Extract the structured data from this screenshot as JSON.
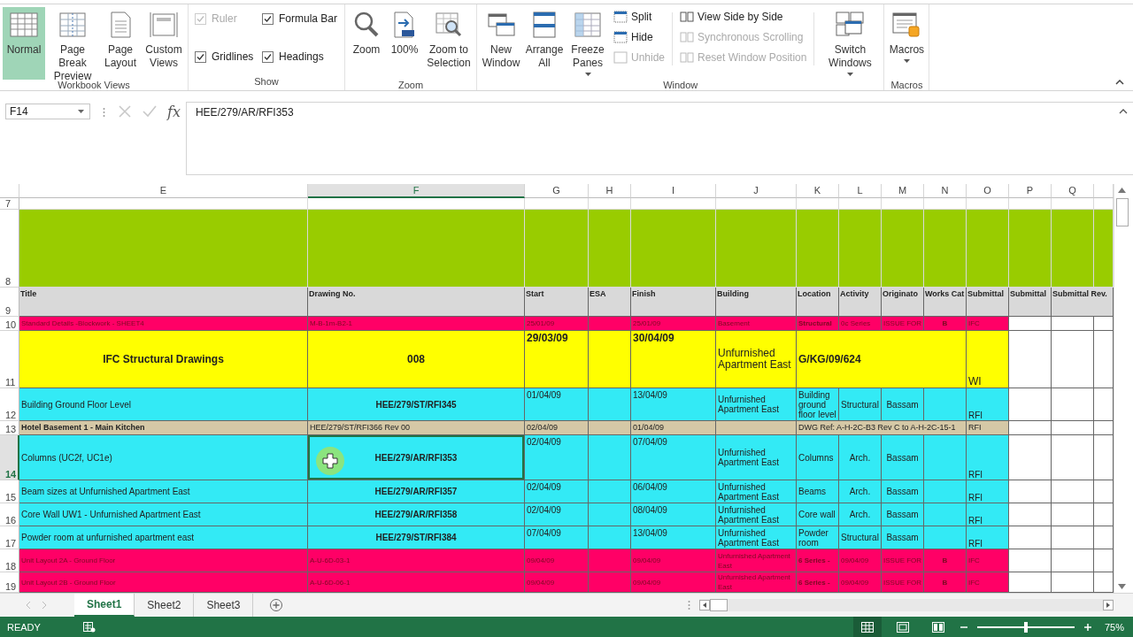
{
  "ribbon": {
    "workbook_views": {
      "label": "Workbook Views",
      "buttons": [
        {
          "label": "Normal",
          "selected": true
        },
        {
          "label": "Page Break Preview",
          "selected": false
        },
        {
          "label": "Page Layout",
          "selected": false
        },
        {
          "label": "Custom Views",
          "selected": false
        }
      ]
    },
    "show": {
      "label": "Show",
      "checks": [
        {
          "label": "Ruler",
          "checked": true,
          "disabled": true
        },
        {
          "label": "Formula Bar",
          "checked": true,
          "disabled": false
        },
        {
          "label": "Gridlines",
          "checked": true,
          "disabled": false
        },
        {
          "label": "Headings",
          "checked": true,
          "disabled": false
        }
      ]
    },
    "zoom": {
      "label": "Zoom",
      "buttons": [
        {
          "label": "Zoom"
        },
        {
          "label": "100%"
        },
        {
          "label": "Zoom to Selection"
        }
      ]
    },
    "window": {
      "label": "Window",
      "big": [
        {
          "label": "New Window"
        },
        {
          "label": "Arrange All"
        },
        {
          "label": "Freeze Panes"
        }
      ],
      "small": [
        {
          "label": "Split",
          "disabled": false
        },
        {
          "label": "Hide",
          "disabled": false
        },
        {
          "label": "Unhide",
          "disabled": true
        }
      ],
      "side": [
        {
          "label": "View Side by Side",
          "disabled": false
        },
        {
          "label": "Synchronous Scrolling",
          "disabled": true
        },
        {
          "label": "Reset Window Position",
          "disabled": true
        }
      ],
      "switch": "Switch Windows"
    },
    "macros": {
      "label": "Macros",
      "button": "Macros"
    }
  },
  "formula_bar": {
    "name_box": "F14",
    "function_label": "fx",
    "formula": "HEE/279/AR/RFI353"
  },
  "sheet": {
    "columns": [
      {
        "letter": "E",
        "selected": false
      },
      {
        "letter": "F",
        "selected": true
      },
      {
        "letter": "G",
        "selected": false
      },
      {
        "letter": "H",
        "selected": false
      },
      {
        "letter": "I",
        "selected": false
      },
      {
        "letter": "J",
        "selected": false
      },
      {
        "letter": "K",
        "selected": false
      },
      {
        "letter": "L",
        "selected": false
      },
      {
        "letter": "M",
        "selected": false
      },
      {
        "letter": "N",
        "selected": false
      },
      {
        "letter": "O",
        "selected": false
      },
      {
        "letter": "P",
        "selected": false
      },
      {
        "letter": "Q",
        "selected": false
      }
    ],
    "rows": [
      {
        "number": "7",
        "selected": false,
        "kind": "blank",
        "cells": []
      },
      {
        "number": "8",
        "selected": false,
        "kind": "band",
        "color": "#99cc00",
        "cells": []
      },
      {
        "number": "9",
        "selected": false,
        "kind": "header",
        "color": "#d9d9d9",
        "cells": [
          "Title",
          "Drawing No.",
          "Start",
          "ESA",
          "Finish",
          "Building",
          "Location",
          "Activity",
          "Originato",
          "Works Cat",
          "Submittal",
          "Submittal",
          "Submittal Rev."
        ]
      },
      {
        "number": "10",
        "selected": false,
        "kind": "red",
        "color": "#ff0066",
        "cells": [
          "Standard Details -Blockwork - SHEET4",
          "M-B-1m-B2-1",
          "25/01/09",
          "",
          "25/01/09",
          "Basement",
          "Structural",
          "0c Series",
          "ISSUE FOR",
          "B",
          "IFC"
        ]
      },
      {
        "number": "11",
        "selected": false,
        "kind": "yellow",
        "color": "#ffff00",
        "cells": [
          "IFC Structural Drawings",
          "008",
          "29/03/09",
          "",
          "30/04/09",
          "Unfurnished Apartment East",
          "G/KG/09/624",
          "",
          "",
          "",
          "WI"
        ]
      },
      {
        "number": "12",
        "selected": false,
        "kind": "cyan",
        "color": "#33eaf5",
        "cells": [
          "Building Ground Floor Level",
          "HEE/279/ST/RFI345",
          "01/04/09",
          "",
          "13/04/09",
          "Unfurnished Apartment East",
          "Building ground floor level",
          "Structural",
          "Bassam",
          "",
          "RFI"
        ]
      },
      {
        "number": "13",
        "selected": false,
        "kind": "tan",
        "color": "#d5c8a6",
        "cells": [
          "Hotel Basement 1 - Main Kitchen",
          "HEE/279/ST/RFI366 Rev 00",
          "02/04/09",
          "",
          "01/04/09",
          "",
          "DWG Ref: A-H-2C-B3 Rev C to A-H-2C-15-1",
          "",
          "",
          "",
          "RFI"
        ]
      },
      {
        "number": "14",
        "selected": true,
        "kind": "cyan",
        "color": "#33eaf5",
        "cells": [
          "Columns (UC2f, UC1e)",
          "HEE/279/AR/RFI353",
          "02/04/09",
          "",
          "07/04/09",
          "Unfurnished Apartment East",
          "Columns",
          "Arch.",
          "Bassam",
          "",
          "RFI"
        ]
      },
      {
        "number": "15",
        "selected": false,
        "kind": "cyan",
        "color": "#33eaf5",
        "cells": [
          "Beam sizes at Unfurnished Apartment East",
          "HEE/279/AR/RFI357",
          "02/04/09",
          "",
          "06/04/09",
          "Unfurnished Apartment East",
          "Beams",
          "Arch.",
          "Bassam",
          "",
          "RFI"
        ]
      },
      {
        "number": "16",
        "selected": false,
        "kind": "cyan",
        "color": "#33eaf5",
        "cells": [
          "Core Wall UW1 - Unfurnished Apartment East",
          "HEE/279/AR/RFI358",
          "02/04/09",
          "",
          "08/04/09",
          "Unfurnished Apartment East",
          "Core wall",
          "Arch.",
          "Bassam",
          "",
          "RFI"
        ]
      },
      {
        "number": "17",
        "selected": false,
        "kind": "cyan",
        "color": "#33eaf5",
        "cells": [
          "Powder room at unfurnished apartment east",
          "HEE/279/ST/RFI384",
          "07/04/09",
          "",
          "13/04/09",
          "Unfurnished Apartment East",
          "Powder room",
          "Structural",
          "Bassam",
          "",
          "RFI"
        ]
      },
      {
        "number": "18",
        "selected": false,
        "kind": "red",
        "color": "#ff0066",
        "cells": [
          "Unit Layout 2A - Ground Floor",
          "A-U-6D-03-1",
          "09/04/09",
          "",
          "09/04/09",
          "Unfurnished Apartment East",
          "6 Series -",
          "09/04/09",
          "ISSUE FOR",
          "B",
          "IFC"
        ]
      },
      {
        "number": "19",
        "selected": false,
        "kind": "red",
        "color": "#ff0066",
        "cells": [
          "Unit Layout 2B - Ground Floor",
          "A-U-6D-06-1",
          "09/04/09",
          "",
          "09/04/09",
          "Unfurnished Apartment East",
          "6 Series -",
          "09/04/09",
          "ISSUE FOR",
          "B",
          "IFC"
        ]
      }
    ]
  },
  "sheet_tabs": [
    {
      "label": "Sheet1",
      "selected": true
    },
    {
      "label": "Sheet2",
      "selected": false
    },
    {
      "label": "Sheet3",
      "selected": false
    }
  ],
  "status_bar": {
    "status": "READY",
    "zoom_percent": "75%",
    "zoom": {
      "level": 0.5
    }
  }
}
